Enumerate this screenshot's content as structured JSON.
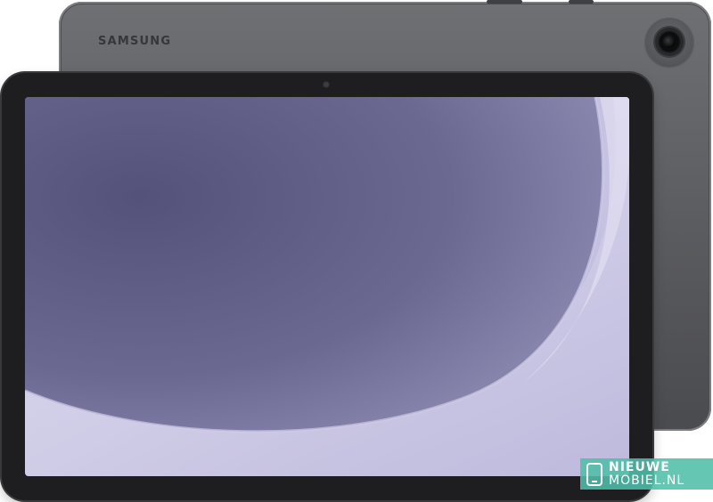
{
  "product": {
    "brand_logo": "SAMSUNG",
    "body_color": "#5e5f62",
    "bezel_color": "#1e1e20"
  },
  "screen": {
    "wallpaper": "purple-curve-wallpaper",
    "colors": {
      "dark": "#5d5b83",
      "mid": "#9c9ac0",
      "light": "#dcd9ef"
    }
  },
  "watermark": {
    "line1": "NIEUWE",
    "line2": "MOBIEL.NL",
    "color": "#50beaa"
  }
}
